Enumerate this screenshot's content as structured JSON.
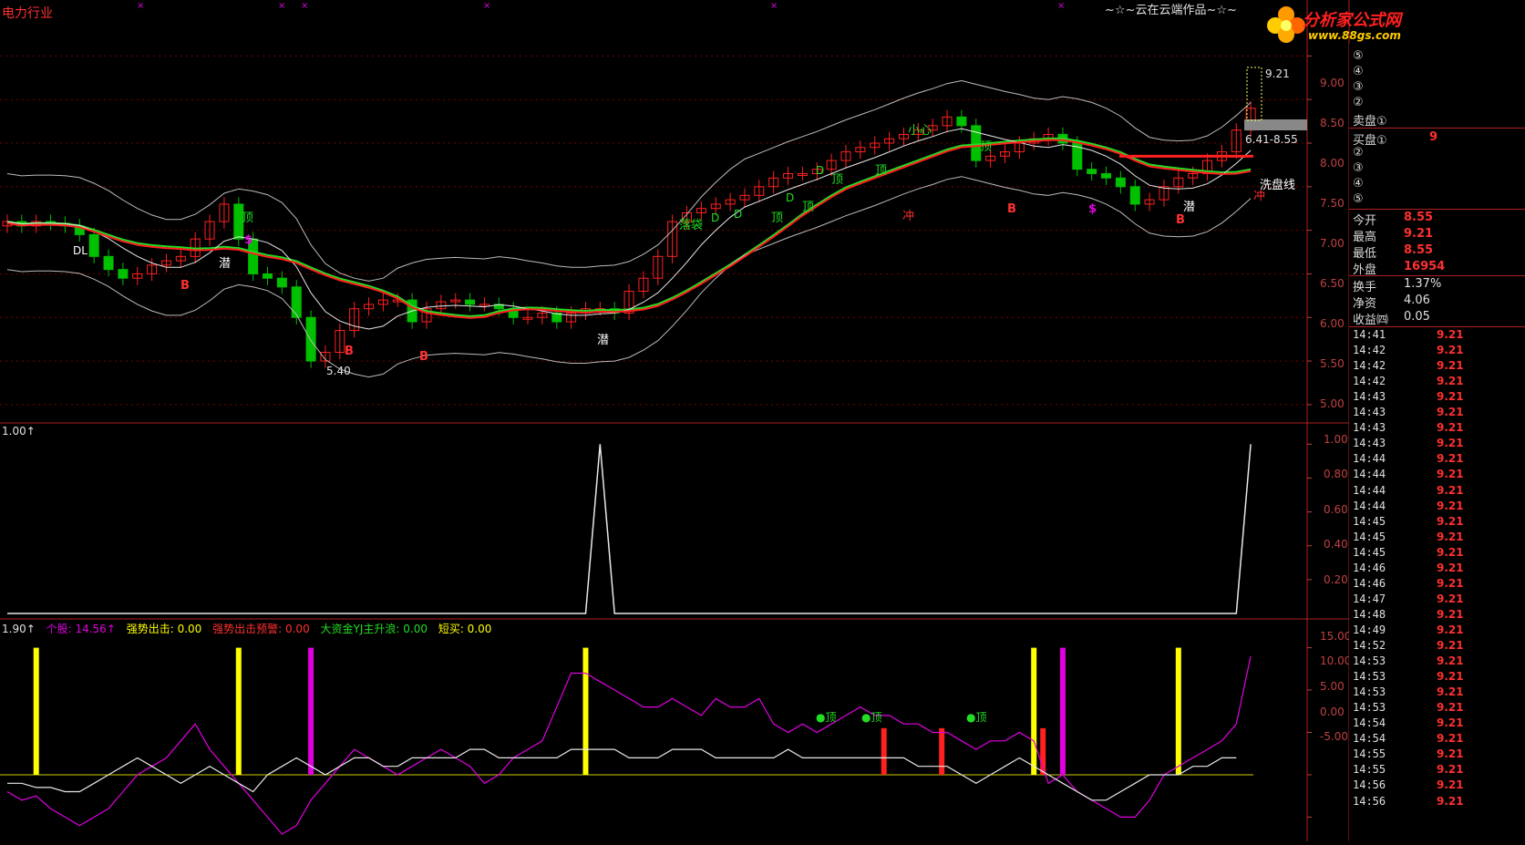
{
  "title": {
    "sector": "电力行业",
    "author": "~☆~云在云端作品~☆~",
    "logo_text": "分析家公式网",
    "logo_url": "www.88gs.com"
  },
  "colors": {
    "bg": "#000000",
    "grid": "#7a0000",
    "axis": "#c04040",
    "up": "#ff2020",
    "down": "#00c000",
    "ma_green": "#22dd22",
    "ma_red": "#ff2020",
    "white": "#e8e8e8",
    "yellow": "#ffff00",
    "magenta": "#e000e0",
    "cyan": "#00ccff"
  },
  "main_panel": {
    "y_ticks": [
      "9.00",
      "8.50",
      "8.00",
      "7.50",
      "7.00",
      "6.50",
      "6.00",
      "5.50",
      "5.00"
    ],
    "labels": {
      "dl": "DL",
      "ding": "顶",
      "qian": "潜",
      "b": "B",
      "dollar": "$",
      "low": "5.40",
      "luodai": "落袋",
      "d": "D",
      "xiaoxin": "小心",
      "chong": "冲",
      "xipan": "洗盘线",
      "range": "6.41-8.55",
      "high": "9.21"
    }
  },
  "mid_panel": {
    "header": "1.00↑",
    "y_ticks": [
      "1.00",
      "0.80",
      "0.60",
      "0.40",
      "0.20"
    ]
  },
  "low_panel": {
    "header": {
      "v1": "1.90↑",
      "v2": "个股: 14.56↑",
      "v3": "强势出击: 0.00",
      "v4": "强势出击预警: 0.00",
      "v5": "大资金YJ主升浪: 0.00",
      "v6": "短买: 0.00"
    },
    "y_ticks": [
      "15.00",
      "10.00",
      "5.00",
      "0.00",
      "-5.00"
    ],
    "labels": {
      "ding": "●顶"
    }
  },
  "side": {
    "ask": [
      {
        "label": "⑤"
      },
      {
        "label": "④"
      },
      {
        "label": "③"
      },
      {
        "label": "②"
      },
      {
        "label": "卖盘①"
      }
    ],
    "bid": [
      {
        "label": "买盘①",
        "value": "9"
      },
      {
        "label": "②",
        "value": ""
      },
      {
        "label": "③",
        "value": ""
      },
      {
        "label": "④",
        "value": ""
      },
      {
        "label": "⑤",
        "value": ""
      }
    ],
    "stats": [
      {
        "label": "今开",
        "value": "8.55"
      },
      {
        "label": "最高",
        "value": "9.21"
      },
      {
        "label": "最低",
        "value": "8.55"
      },
      {
        "label": "外盘",
        "value": "16954"
      },
      {
        "label": "换手",
        "value": "1.37%"
      },
      {
        "label": "净资",
        "value": "4.06"
      },
      {
        "label": "收益㈣",
        "value": "0.05"
      }
    ],
    "ticks": [
      {
        "t": "14:41",
        "p": "9.21"
      },
      {
        "t": "14:42",
        "p": "9.21"
      },
      {
        "t": "14:42",
        "p": "9.21"
      },
      {
        "t": "14:42",
        "p": "9.21"
      },
      {
        "t": "14:43",
        "p": "9.21"
      },
      {
        "t": "14:43",
        "p": "9.21"
      },
      {
        "t": "14:43",
        "p": "9.21"
      },
      {
        "t": "14:43",
        "p": "9.21"
      },
      {
        "t": "14:44",
        "p": "9.21"
      },
      {
        "t": "14:44",
        "p": "9.21"
      },
      {
        "t": "14:44",
        "p": "9.21"
      },
      {
        "t": "14:44",
        "p": "9.21"
      },
      {
        "t": "14:45",
        "p": "9.21"
      },
      {
        "t": "14:45",
        "p": "9.21"
      },
      {
        "t": "14:45",
        "p": "9.21"
      },
      {
        "t": "14:46",
        "p": "9.21"
      },
      {
        "t": "14:46",
        "p": "9.21"
      },
      {
        "t": "14:47",
        "p": "9.21"
      },
      {
        "t": "14:48",
        "p": "9.21"
      },
      {
        "t": "14:49",
        "p": "9.21"
      },
      {
        "t": "14:52",
        "p": "9.21"
      },
      {
        "t": "14:53",
        "p": "9.21"
      },
      {
        "t": "14:53",
        "p": "9.21"
      },
      {
        "t": "14:53",
        "p": "9.21"
      },
      {
        "t": "14:53",
        "p": "9.21"
      },
      {
        "t": "14:54",
        "p": "9.21"
      },
      {
        "t": "14:54",
        "p": "9.21"
      },
      {
        "t": "14:55",
        "p": "9.21"
      },
      {
        "t": "14:55",
        "p": "9.21"
      },
      {
        "t": "14:56",
        "p": "9.21"
      },
      {
        "t": "14:56",
        "p": "9.21"
      }
    ]
  },
  "chart_data": [
    {
      "type": "candlestick",
      "title": "电力行业",
      "y_range": [
        4.8,
        9.6
      ],
      "close_series": [
        7.1,
        7.05,
        7.1,
        7.08,
        7.05,
        6.95,
        6.7,
        6.55,
        6.45,
        6.5,
        6.6,
        6.65,
        6.7,
        6.9,
        7.1,
        7.3,
        6.9,
        6.5,
        6.45,
        6.35,
        6.0,
        5.5,
        5.6,
        5.85,
        6.1,
        6.15,
        6.2,
        6.2,
        5.95,
        6.1,
        6.18,
        6.2,
        6.15,
        6.15,
        6.1,
        6.0,
        6.0,
        6.05,
        5.95,
        6.05,
        6.1,
        6.1,
        6.05,
        6.3,
        6.45,
        6.7,
        7.1,
        7.2,
        7.25,
        7.3,
        7.35,
        7.4,
        7.5,
        7.6,
        7.65,
        7.65,
        7.7,
        7.8,
        7.9,
        7.95,
        8.0,
        8.05,
        8.1,
        8.15,
        8.2,
        8.3,
        8.2,
        7.8,
        7.85,
        7.9,
        8.0,
        8.05,
        8.1,
        8.0,
        7.7,
        7.65,
        7.6,
        7.5,
        7.3,
        7.35,
        7.5,
        7.6,
        7.65,
        7.8,
        7.9,
        8.15,
        8.4
      ]
    },
    {
      "type": "line",
      "title": "1.00↑",
      "y_range": [
        0,
        1.05
      ],
      "values": [
        0,
        0,
        0,
        0,
        0,
        0,
        0,
        0,
        0,
        0,
        0,
        0,
        0,
        0,
        0,
        0,
        0,
        0,
        0,
        0,
        0,
        0,
        0,
        0,
        0,
        0,
        0,
        0,
        0,
        0,
        0,
        0,
        0,
        0,
        0,
        0,
        0,
        0,
        0,
        0,
        0,
        1,
        0,
        0,
        0,
        0,
        0,
        0,
        0,
        0,
        0,
        0,
        0,
        0,
        0,
        0,
        0,
        0,
        0,
        0,
        0,
        0,
        0,
        0,
        0,
        0,
        0,
        0,
        0,
        0,
        0,
        0,
        0,
        0,
        0,
        0,
        0,
        0,
        0,
        0,
        0,
        0,
        0,
        0,
        0,
        0,
        1
      ]
    },
    {
      "type": "line",
      "title": "1.90↑",
      "y_range": [
        -7,
        17
      ],
      "series": [
        {
          "name": "个股",
          "values": [
            -2,
            -3,
            -2.5,
            -4,
            -5,
            -6,
            -5,
            -4,
            -2,
            0,
            1,
            2,
            4,
            6,
            3,
            1,
            -1,
            -3,
            -5,
            -7,
            -6,
            -3,
            -1,
            1,
            3,
            2,
            1,
            0,
            1,
            2,
            3,
            2,
            1,
            -1,
            0,
            2,
            3,
            4,
            8,
            12,
            12,
            11,
            10,
            9,
            8,
            8,
            9,
            8,
            7,
            9,
            8,
            8,
            9,
            6,
            5,
            6,
            5,
            6,
            7,
            8,
            7,
            7,
            6,
            6,
            5,
            5,
            4,
            3,
            4,
            4,
            5,
            4,
            -1,
            0,
            -2,
            -3,
            -4,
            -5,
            -5,
            -3,
            0,
            1,
            2,
            3,
            4,
            6,
            14
          ]
        },
        {
          "name": "",
          "values": [
            -1,
            -1,
            -1.5,
            -1.5,
            -2,
            -2,
            -1,
            0,
            1,
            2,
            1,
            0,
            -1,
            0,
            1,
            0,
            -1,
            -2,
            0,
            1,
            2,
            1,
            0,
            1,
            2,
            2,
            1,
            1,
            2,
            2,
            2,
            2,
            3,
            3,
            2,
            2,
            2,
            2,
            2,
            3,
            3,
            3,
            3,
            2,
            2,
            2,
            3,
            3,
            3,
            2,
            2,
            2,
            2,
            2,
            3,
            2,
            2,
            2,
            2,
            2,
            2,
            2,
            2,
            1,
            1,
            1,
            0,
            -1,
            0,
            1,
            2,
            1,
            0,
            -1,
            -2,
            -3,
            -3,
            -2,
            -1,
            0,
            0,
            0,
            1,
            1,
            2,
            2
          ]
        }
      ]
    }
  ]
}
